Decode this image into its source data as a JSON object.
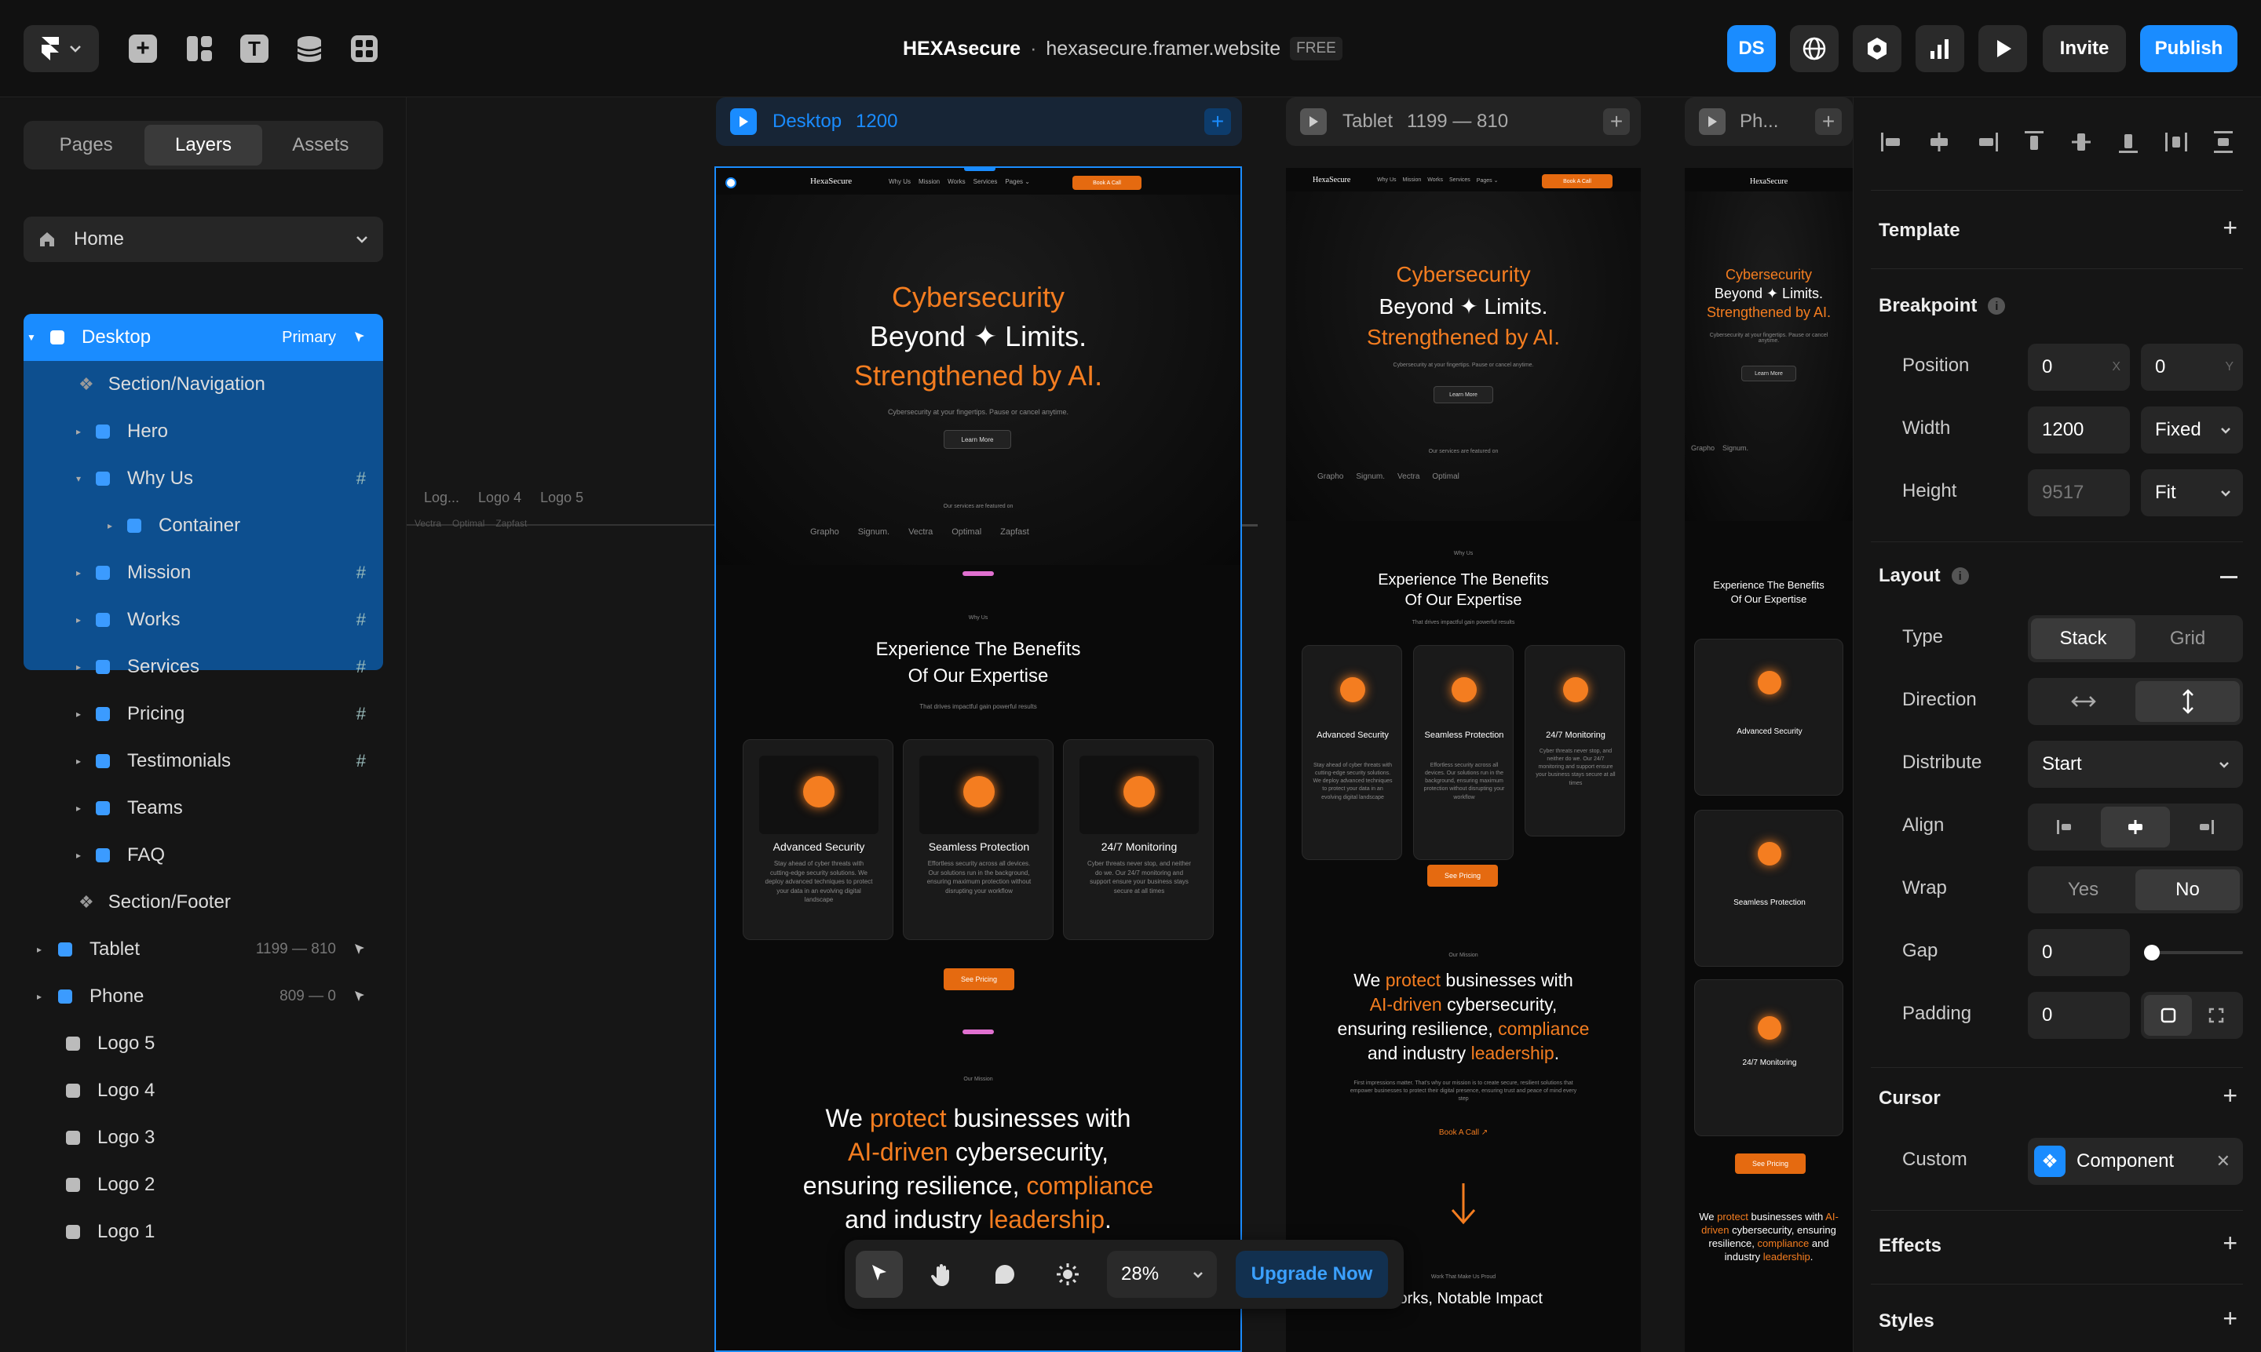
{
  "topbar": {
    "project_name": "HEXAsecure",
    "separator": "·",
    "domain": "hexasecure.framer.website",
    "plan_badge": "FREE",
    "avatar_initials": "DS",
    "invite_label": "Invite",
    "publish_label": "Publish"
  },
  "left_panel": {
    "tabs": [
      "Pages",
      "Layers",
      "Assets"
    ],
    "page_select": "Home",
    "layers": [
      {
        "label": "Desktop",
        "badge": "Primary"
      },
      {
        "label": "Section/Navigation"
      },
      {
        "label": "Hero"
      },
      {
        "label": "Why Us"
      },
      {
        "label": "Container"
      },
      {
        "label": "Mission"
      },
      {
        "label": "Works"
      },
      {
        "label": "Services"
      },
      {
        "label": "Pricing"
      },
      {
        "label": "Testimonials"
      },
      {
        "label": "Teams"
      },
      {
        "label": "FAQ"
      },
      {
        "label": "Section/Footer"
      },
      {
        "label": "Tablet",
        "size": "1199 — 810"
      },
      {
        "label": "Phone",
        "size": "809 — 0"
      },
      {
        "label": "Logo 5"
      },
      {
        "label": "Logo 4"
      },
      {
        "label": "Logo 3"
      },
      {
        "label": "Logo 2"
      },
      {
        "label": "Logo 1"
      }
    ],
    "hash_symbol": "#"
  },
  "canvas": {
    "desktop_label": "Desktop",
    "desktop_width": "1200",
    "tablet_label": "Tablet",
    "tablet_range": "1199 — 810",
    "phone_label": "Ph...",
    "side_logos": [
      "Log...",
      "Logo 4",
      "Logo 5"
    ],
    "side_logo_marks": [
      "Vectra",
      "Optimal",
      "Zapfast"
    ],
    "site": {
      "brand": "HexaSecure",
      "nav": [
        "Why Us",
        "Mission",
        "Works",
        "Services",
        "Pages ⌄"
      ],
      "nav_cta": "Book A Call",
      "hero_line1": "Cybersecurity",
      "hero_line2": "Beyond ✦ Limits.",
      "hero_line3": "Strengthened by AI.",
      "hero_sub": "Cybersecurity at your fingertips. Pause or cancel anytime.",
      "hero_cta": "Learn More",
      "featured": "Our services are featured on",
      "logos": [
        "Grapho",
        "Signum.",
        "Vectra",
        "Optimal",
        "Zapfast"
      ],
      "why_tag": "Why Us",
      "why_title1": "Experience The Benefits",
      "why_title2": "Of Our Expertise",
      "why_sub": "That drives impactful gain powerful results",
      "cards": [
        {
          "title": "Advanced Security",
          "body": "Stay ahead of cyber threats with cutting-edge security solutions. We deploy advanced techniques to protect your data in an evolving digital landscape"
        },
        {
          "title": "Seamless Protection",
          "body": "Effortless security across all devices. Our solutions run in the background, ensuring maximum protection without disrupting your workflow"
        },
        {
          "title": "24/7 Monitoring",
          "body": "Cyber threats never stop, and neither do we. Our 24/7 monitoring and support ensure your business stays secure at all times"
        }
      ],
      "pricing_cta": "See Pricing",
      "mission_tag": "Our Mission",
      "mission_w1": "We",
      "mission_w2": "protect",
      "mission_w3": "businesses with",
      "mission_w4": "AI-driven",
      "mission_w5": "cybersecurity,",
      "mission_w6": "ensuring resilience,",
      "mission_w7": "compliance",
      "mission_w8": "and industry",
      "mission_w9": "leadership",
      "mission_w10": ".",
      "mission_body": "First impressions matter. That's why our mission is to create secure, resilient solutions that empower businesses to protect their digital presence, ensuring trust and peace of mind every step",
      "book_call": "Book A Call ↗",
      "works_tag": "Work That Make Us Proud",
      "works_title": "Works, Notable Impact"
    }
  },
  "bottom_toolbar": {
    "zoom": "28%",
    "upgrade_label": "Upgrade Now"
  },
  "right_panel": {
    "template_label": "Template",
    "breakpoint_label": "Breakpoint",
    "position_label": "Position",
    "position_x": "0",
    "position_x_axis": "X",
    "position_y": "0",
    "position_y_axis": "Y",
    "width_label": "Width",
    "width_value": "1200",
    "width_mode": "Fixed",
    "height_label": "Height",
    "height_value": "9517",
    "height_mode": "Fit",
    "layout_label": "Layout",
    "type_label": "Type",
    "type_options": [
      "Stack",
      "Grid"
    ],
    "direction_label": "Direction",
    "distribute_label": "Distribute",
    "distribute_value": "Start",
    "align_label": "Align",
    "wrap_label": "Wrap",
    "wrap_options": [
      "Yes",
      "No"
    ],
    "gap_label": "Gap",
    "gap_value": "0",
    "padding_label": "Padding",
    "padding_value": "0",
    "cursor_label": "Cursor",
    "custom_label": "Custom",
    "component_label": "Component",
    "effects_label": "Effects",
    "styles_label": "Styles"
  },
  "colors": {
    "accent": "#1a8cff",
    "brand_orange": "#f47d20",
    "selection": "#0d4f8f"
  }
}
